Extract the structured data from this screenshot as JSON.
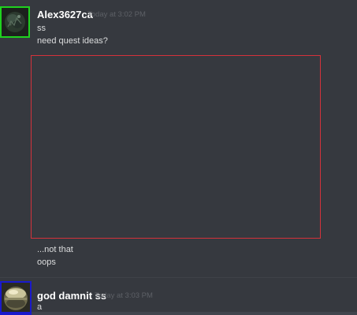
{
  "messages": [
    {
      "author": "Alex3627ca",
      "timestamp": "Today at 3:02 PM",
      "lines_before_image": [
        "ss",
        "need quest ideas?"
      ],
      "lines_after_image": [
        "...not that",
        "oops"
      ]
    },
    {
      "author": "god damnit ss",
      "timestamp": "Today at 3:03 PM",
      "lines": [
        "a"
      ]
    }
  ],
  "colors": {
    "background": "#36393f",
    "username": "#ffffff",
    "timestamp": "#5d6066",
    "message_text": "#dcddde",
    "avatar_border_1": "#1fd21f",
    "avatar_border_2": "#1a1acc",
    "image_outline": "#d5323b"
  },
  "icons": {
    "avatar_1": "dark-mossy-orb-avatar",
    "avatar_2": "metallic-sphere-avatar"
  }
}
